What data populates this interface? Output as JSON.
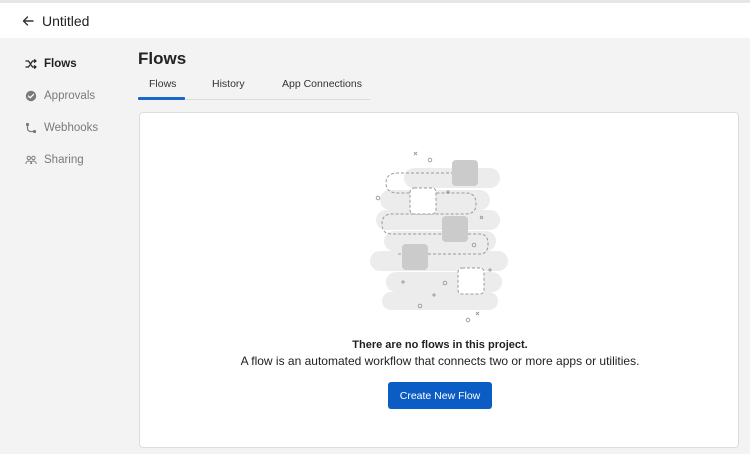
{
  "header": {
    "title": "Untitled",
    "back_icon": "arrow-left-icon"
  },
  "sidebar": {
    "items": [
      {
        "label": "Flows",
        "icon": "shuffle-icon",
        "active": true
      },
      {
        "label": "Approvals",
        "icon": "check-circle-icon",
        "active": false
      },
      {
        "label": "Webhooks",
        "icon": "webhook-icon",
        "active": false
      },
      {
        "label": "Sharing",
        "icon": "people-icon",
        "active": false
      }
    ]
  },
  "main": {
    "title": "Flows",
    "tabs": [
      {
        "label": "Flows",
        "active": true
      },
      {
        "label": "History",
        "active": false
      },
      {
        "label": "App Connections",
        "active": false
      }
    ]
  },
  "empty_state": {
    "title": "There are no flows in this project.",
    "description": "A flow is an automated workflow that connects two or more apps or utilities.",
    "button_label": "Create New Flow"
  },
  "colors": {
    "accent": "#0b5cc4",
    "tab_underline": "#1a66c9",
    "background": "#f3f3f3"
  }
}
